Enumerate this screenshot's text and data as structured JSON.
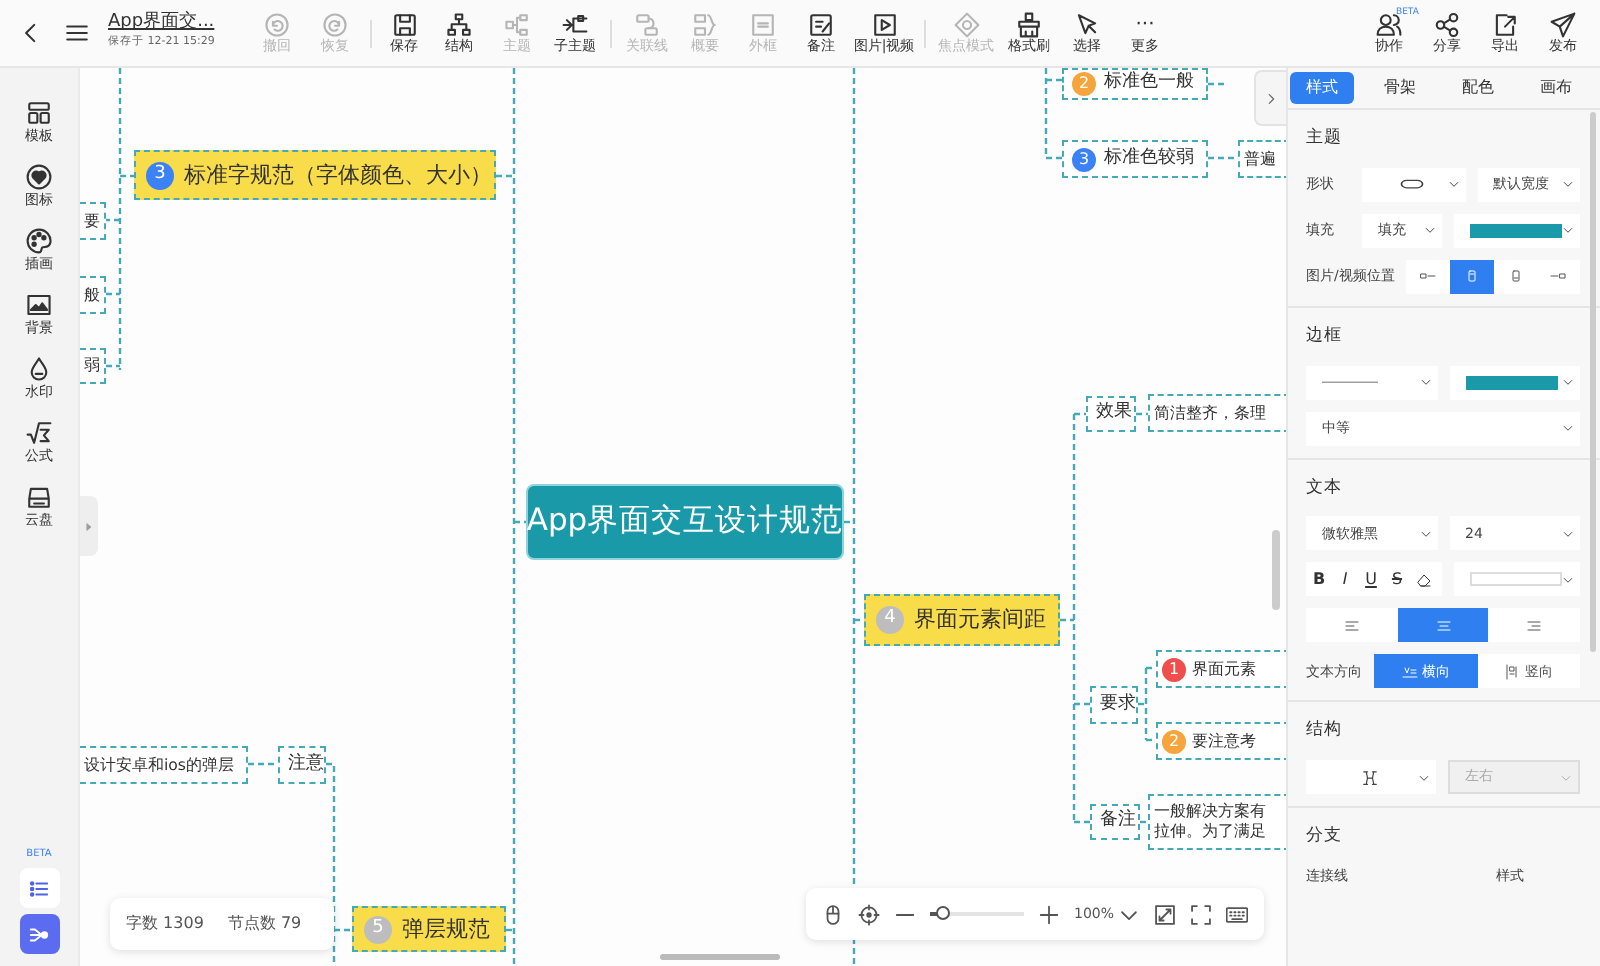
{
  "toolbar": {
    "title": "App界面交...",
    "saved": "保存于 12-21 15:29",
    "buttons": [
      {
        "label": "撤回",
        "disabled": true
      },
      {
        "label": "恢复",
        "disabled": true
      },
      {
        "label": "保存",
        "disabled": false
      },
      {
        "label": "结构",
        "disabled": false
      },
      {
        "label": "主题",
        "disabled": true
      },
      {
        "label": "子主题",
        "disabled": false
      },
      {
        "label": "关联线",
        "disabled": true
      },
      {
        "label": "概要",
        "disabled": true
      },
      {
        "label": "外框",
        "disabled": true
      },
      {
        "label": "备注",
        "disabled": false
      },
      {
        "label": "图片|视频",
        "disabled": false
      },
      {
        "label": "焦点模式",
        "disabled": true
      },
      {
        "label": "格式刷",
        "disabled": false
      },
      {
        "label": "选择",
        "disabled": false
      },
      {
        "label": "更多",
        "glyph": "···",
        "disabled": false
      }
    ],
    "right_buttons": [
      {
        "label": "协作",
        "badge": "BETA"
      },
      {
        "label": "分享"
      },
      {
        "label": "导出"
      },
      {
        "label": "发布"
      }
    ]
  },
  "sidebar": {
    "items": [
      {
        "label": "模板"
      },
      {
        "label": "图标"
      },
      {
        "label": "插画"
      },
      {
        "label": "背景"
      },
      {
        "label": "水印"
      },
      {
        "label": "公式"
      },
      {
        "label": "云盘"
      }
    ],
    "beta_label": "BETA",
    "views": [
      {
        "selected": false
      },
      {
        "selected": true
      }
    ]
  },
  "canvas": {
    "nodes": [
      {
        "kind": "root",
        "text": "App界面交互设计规范"
      },
      {
        "kind": "topic",
        "text": "标准字规范（字体颜色、大小）",
        "marker": "3",
        "color": "#3b82f6"
      },
      {
        "kind": "plain",
        "text": "要"
      },
      {
        "kind": "plain",
        "text": "般"
      },
      {
        "kind": "plain",
        "text": "弱"
      },
      {
        "kind": "plain",
        "text": "设计安卓和ios的弹层"
      },
      {
        "kind": "plain",
        "text": "注意"
      },
      {
        "kind": "topic",
        "text": "弹层规范",
        "marker": "5",
        "color": "#bdbdbd"
      },
      {
        "kind": "plain",
        "text": "标准色一般",
        "marker": "2",
        "color": "#f5a53c"
      },
      {
        "kind": "plain",
        "text": "标准色较弱",
        "marker": "3",
        "color": "#3b82f6"
      },
      {
        "kind": "plain",
        "text": "普遍"
      },
      {
        "kind": "topic",
        "text": "界面元素间距",
        "marker": "4",
        "color": "#bdbdbd"
      },
      {
        "kind": "plain",
        "text": "效果"
      },
      {
        "kind": "plain",
        "text": "简洁整齐，条理"
      },
      {
        "kind": "plain",
        "text": "要求"
      },
      {
        "kind": "plain",
        "text": "界面元素",
        "marker": "1",
        "color": "#f04d4d"
      },
      {
        "kind": "plain",
        "text": "要注意考",
        "marker": "2",
        "color": "#f5a53c"
      },
      {
        "kind": "plain",
        "text": "备注"
      },
      {
        "kind": "plain",
        "lines": [
          "一般解决方案有",
          "拉伸。为了满足"
        ]
      }
    ],
    "stats": [
      {
        "label": "字数 1309"
      },
      {
        "label": "节点数 79"
      }
    ],
    "zoom": {
      "level": 0.12,
      "value": "100%"
    }
  },
  "panel": {
    "tabs": [
      {
        "label": "样式",
        "selected": true
      },
      {
        "label": "骨架",
        "selected": false
      },
      {
        "label": "配色",
        "selected": false
      },
      {
        "label": "画布",
        "selected": false
      }
    ],
    "sections": [
      {
        "title": "主题",
        "rows": [
          {
            "kind": "pair",
            "label": "形状",
            "fields": [
              {
                "kind": "shape"
              },
              {
                "kind": "text",
                "value": "默认宽度"
              }
            ]
          },
          {
            "kind": "pair",
            "label": "填充",
            "fields": [
              {
                "kind": "text",
                "value": "填充"
              },
              {
                "kind": "color",
                "color": "#1a9aa8"
              }
            ]
          },
          {
            "kind": "segments",
            "label": "图片/视频位置",
            "options": [
              {
                "selected": false
              },
              {
                "selected": true
              },
              {
                "selected": false
              },
              {
                "selected": false
              }
            ]
          }
        ]
      },
      {
        "title": "边框",
        "rows": [
          {
            "kind": "pair",
            "fields": [
              {
                "kind": "line"
              },
              {
                "kind": "color",
                "color": "#1a9aa8"
              }
            ]
          },
          {
            "kind": "pair",
            "fields": [
              {
                "kind": "text",
                "value": "中等"
              }
            ]
          }
        ]
      },
      {
        "title": "文本",
        "rows": [
          {
            "kind": "pair",
            "fields": [
              {
                "kind": "text",
                "value": "微软雅黑"
              },
              {
                "kind": "text",
                "value": "24"
              }
            ]
          },
          {
            "kind": "format",
            "buttons": [
              {
                "kind": "bold",
                "label": "B"
              },
              {
                "kind": "italic",
                "label": "I"
              },
              {
                "kind": "underline",
                "label": "U"
              },
              {
                "kind": "strike",
                "label": "S"
              },
              {
                "kind": "eraser"
              }
            ],
            "fields": [
              {
                "kind": "blank"
              }
            ]
          },
          {
            "kind": "segments",
            "options": [
              {
                "selected": false
              },
              {
                "selected": true
              },
              {
                "selected": false
              }
            ]
          },
          {
            "kind": "segments",
            "label": "文本方向",
            "options": [
              {
                "text": "横向",
                "selected": true
              },
              {
                "text": "竖向",
                "selected": false
              }
            ]
          }
        ]
      },
      {
        "title": "结构",
        "rows": [
          {
            "kind": "pair",
            "fields": [
              {
                "kind": "structure",
                "disabled": false
              },
              {
                "kind": "text",
                "value": "左右",
                "disabled": true
              }
            ]
          }
        ]
      },
      {
        "title": "分支",
        "rows": [
          {
            "kind": "labels",
            "labels": [
              "连接线",
              "样式"
            ]
          }
        ]
      }
    ]
  }
}
